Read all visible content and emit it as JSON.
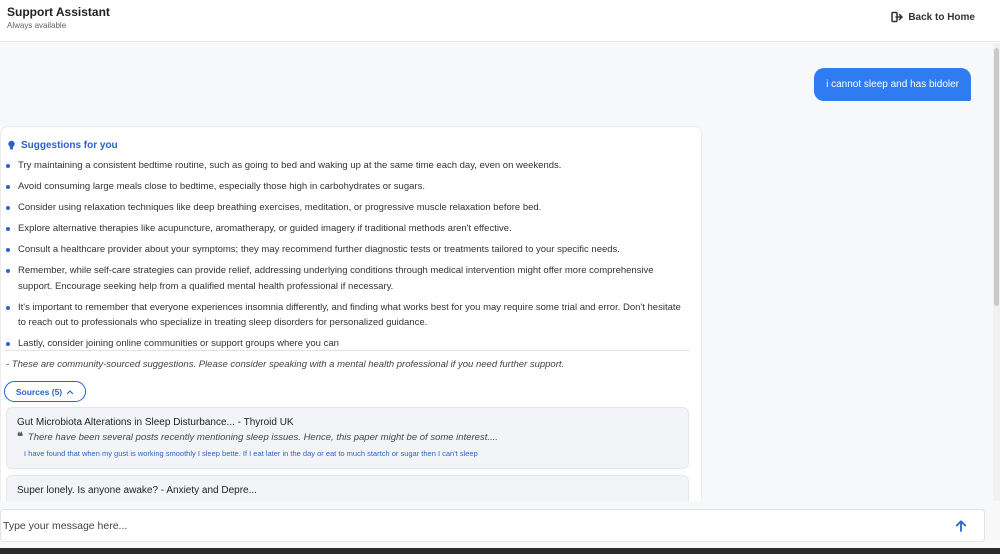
{
  "header": {
    "title": "Support Assistant",
    "subtitle": "Always available",
    "back_label": "Back to Home",
    "back_icon": "sign-out-icon"
  },
  "chat": {
    "user_message": "i cannot sleep and has bidoler",
    "assistant": {
      "suggestions_title": "Suggestions for you",
      "suggestions_icon": "lightbulb-icon",
      "accent_color": "#2a62c9",
      "suggestions": [
        "Try maintaining a consistent bedtime routine, such as going to bed and waking up at the same time each day, even on weekends.",
        "Avoid consuming large meals close to bedtime, especially those high in carbohydrates or sugars.",
        "Consider using relaxation techniques like deep breathing exercises, meditation, or progressive muscle relaxation before bed.",
        "Explore alternative therapies like acupuncture, aromatherapy, or guided imagery if traditional methods aren't effective.",
        "Consult a healthcare provider about your symptoms; they may recommend further diagnostic tests or treatments tailored to your specific needs.",
        "Remember, while self-care strategies can provide relief, addressing underlying conditions through medical intervention might offer more comprehensive support. Encourage seeking help from a qualified mental health professional if necessary.",
        "It's important to remember that everyone experiences insomnia differently, and finding what works best for you may require some trial and error. Don't hesitate to reach out to professionals who specialize in treating sleep disorders for personalized guidance.",
        "Lastly, consider joining online communities or support groups where you can"
      ],
      "disclaimer": "- These are community-sourced suggestions. Please consider speaking with a mental health professional if you need further support.",
      "sources_label": "Sources (5)",
      "sources": [
        {
          "title": "Gut Microbiota Alterations in Sleep Disturbance... - Thyroid UK",
          "quote": "There have been several posts recently mentioning sleep issues. Hence, this paper might be of some interest....",
          "excerpt": "I have found that when my gust is working smoothly I sleep bette. If I eat later in the day or eat to much startch or sugar then I can't sleep"
        },
        {
          "title": "Super lonely. Is anyone awake? - Anxiety and Depre..."
        }
      ]
    }
  },
  "input": {
    "placeholder": "Type your message here...",
    "send_icon": "arrow-up-icon",
    "user_bubble_color": "#2f7bf2"
  }
}
